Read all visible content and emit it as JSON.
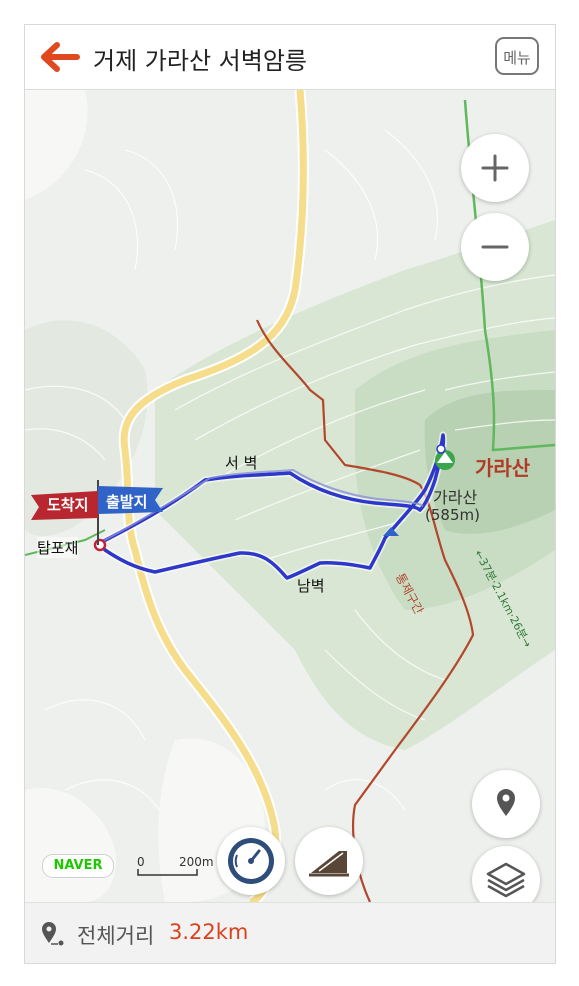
{
  "header": {
    "title": "거제  가라산 서벽암릉",
    "menu_label": "메뉴"
  },
  "map": {
    "labels": {
      "peak_name": "가라산",
      "peak_name_small": "가라산",
      "peak_elevation": "(585m)",
      "west_wall": "서 벽",
      "south_wall": "남벽",
      "start_point": "탑포재",
      "restricted": "통제구간",
      "trail_time": "←37분·2.1km·26분→"
    },
    "flags": {
      "arrival": "도착지",
      "departure": "출발지"
    },
    "naver_logo": "NAVER",
    "scale": {
      "left": "0",
      "right": "200m"
    },
    "colors": {
      "route": "#2d37c9",
      "road": "#f6dd8b",
      "restricted_trail": "#b2472c",
      "arrival_flag": "#b8262f",
      "departure_flag": "#2f63c8"
    },
    "controls": {
      "zoom_in_icon": "plus-icon",
      "zoom_out_icon": "minus-icon",
      "location_icon": "location-pin-icon",
      "layers_icon": "layers-icon",
      "compass_icon": "gauge-icon",
      "elevation_icon": "elevation-chart-icon"
    }
  },
  "footer": {
    "distance_label": "전체거리",
    "distance_value": "3.22km"
  }
}
